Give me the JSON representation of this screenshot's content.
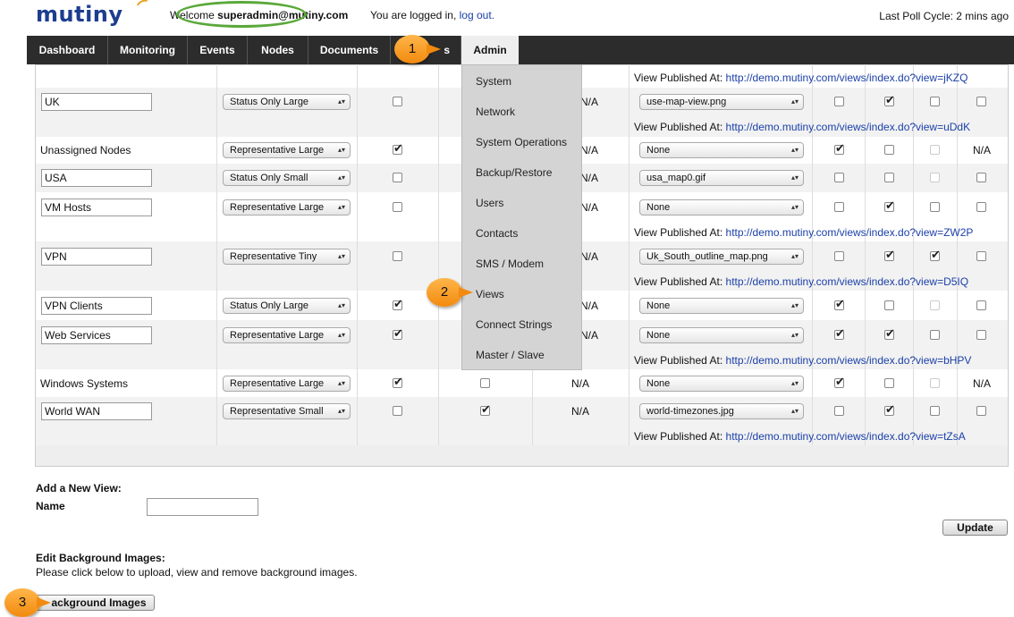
{
  "header": {
    "logo": "mutiny",
    "welcome_prefix": "Welcome ",
    "welcome_user": "superadmin@mutiny.com",
    "logged_in_text": "You are logged in, ",
    "logout_link": "log out.",
    "last_poll": "Last Poll Cycle: 2 mins ago"
  },
  "nav": {
    "tabs": [
      "Dashboard",
      "Monitoring",
      "Events",
      "Nodes",
      "Documents",
      "Reports",
      "Admin"
    ],
    "visible_reports_fragment": "s",
    "active": "Admin"
  },
  "admin_menu": [
    "System",
    "Network",
    "System Operations",
    "Backup/Restore",
    "Users",
    "Contacts",
    "SMS / Modem",
    "Views",
    "Connect Strings",
    "Master / Slave"
  ],
  "table": {
    "published_prefix": "View Published At: ",
    "na": "N/A",
    "rows": [
      {
        "name": "UK",
        "editable": true,
        "style": "Status Only Large",
        "background": "use-map-view.png",
        "published_top": "http://demo.mutiny.com/views/index.do?view=jKZQ",
        "published_bottom": "http://demo.mutiny.com/views/index.do?view=uDdK"
      },
      {
        "name": "Unassigned Nodes",
        "editable": false,
        "style": "Representative Large",
        "background": "None"
      },
      {
        "name": "USA",
        "editable": true,
        "style": "Status Only Small",
        "background": "usa_map0.gif"
      },
      {
        "name": "VM Hosts",
        "editable": true,
        "style": "Representative Large",
        "background": "None",
        "published_bottom": "http://demo.mutiny.com/views/index.do?view=ZW2P"
      },
      {
        "name": "VPN",
        "editable": true,
        "style": "Representative Tiny",
        "background": "Uk_South_outline_map.png",
        "published_bottom": "http://demo.mutiny.com/views/index.do?view=D5IQ"
      },
      {
        "name": "VPN Clients",
        "editable": true,
        "style": "Status Only Large",
        "background": "None"
      },
      {
        "name": "Web Services",
        "editable": true,
        "style": "Representative Large",
        "background": "None",
        "published_bottom": "http://demo.mutiny.com/views/index.do?view=bHPV"
      },
      {
        "name": "Windows Systems",
        "editable": false,
        "style": "Representative Large",
        "background": "None"
      },
      {
        "name": "World WAN",
        "editable": true,
        "style": "Representative Small",
        "background": "world-timezones.jpg",
        "published_bottom": "http://demo.mutiny.com/views/index.do?view=tZsA"
      }
    ]
  },
  "add_view": {
    "heading": "Add a New View:",
    "name_label": "Name",
    "name_value": ""
  },
  "update_button": "Update",
  "edit_bg": {
    "heading": "Edit Background Images:",
    "description": "Please click below to upload, view and remove background images.",
    "button": "Background Images",
    "button_visible_text": "ackground Images"
  },
  "callouts": [
    "1",
    "2",
    "3"
  ],
  "colors": {
    "nav_bg": "#2c2c2c",
    "link": "#1a3fa8",
    "callout": "#f59a1c",
    "highlight_oval": "#5aa83a"
  }
}
